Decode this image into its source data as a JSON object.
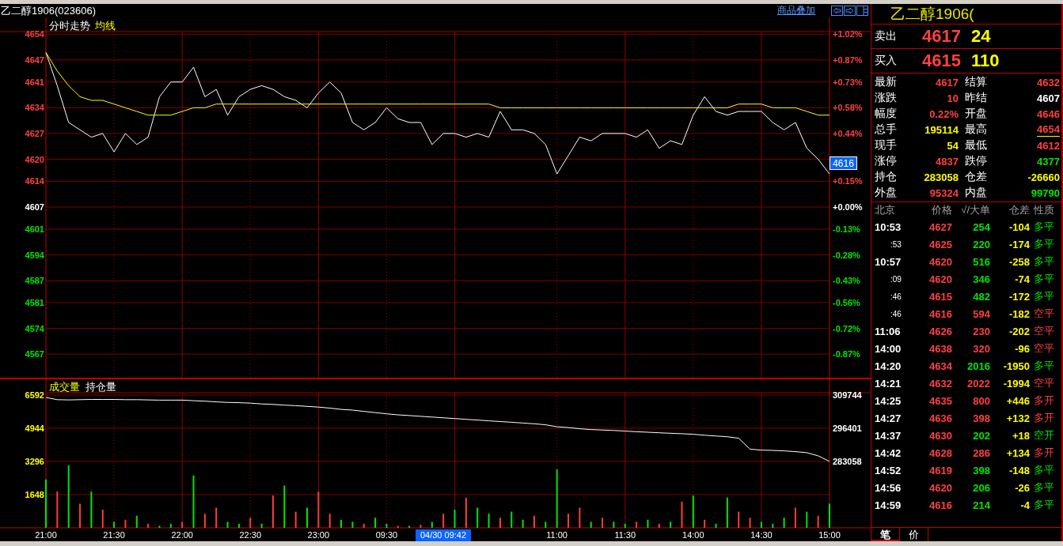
{
  "window": {
    "title": "乙二醇1906(023606)"
  },
  "overlay_link": "商品叠加",
  "price_chart": {
    "last_price_tag": "4616",
    "axis_labels": [
      {
        "percent": "+1.02%",
        "color": "#ff4040"
      },
      {
        "percent": "+0.87%",
        "color": "#ff4040"
      },
      {
        "percent": "+0.73%",
        "color": "#ff4040"
      },
      {
        "percent": "+0.58%",
        "color": "#ff4040"
      },
      {
        "percent": "+0.44%",
        "color": "#ff4040"
      },
      {
        "color": "#ff4040"
      },
      {
        "percent": "+0.15%",
        "color": "#ff4040"
      },
      {
        "percent": "+0.00%",
        "color": "#ffffff"
      },
      {
        "percent": "-0.13%",
        "color": "#00e600"
      },
      {
        "percent": "-0.28%",
        "color": "#00e600"
      },
      {
        "percent": "-0.43%",
        "color": "#00e600"
      },
      {
        "percent": "-0.56%",
        "color": "#00e600"
      },
      {
        "percent": "-0.72%",
        "color": "#00e600"
      },
      {
        "percent": "-0.87%",
        "color": "#00e600"
      }
    ],
    "chart_data": {
      "type": "line",
      "grid": true,
      "ylim": [
        4560.6,
        4654.7
      ],
      "yticks": [
        4654,
        4647,
        4641,
        4634,
        4627,
        4620,
        4614,
        4607,
        4601,
        4594,
        4587,
        4581,
        4574,
        4567
      ],
      "series": [
        {
          "name": "分时走势",
          "color": "#ffffff",
          "values": [
            4649,
            4640,
            4630,
            4628,
            4626,
            4627,
            4622,
            4627,
            4624,
            4626,
            4637,
            4641,
            4641,
            4645,
            4637,
            4639,
            4632,
            4637,
            4639,
            4640,
            4639,
            4637,
            4636,
            4634,
            4638,
            4641,
            4638,
            4630,
            4628,
            4630,
            4634,
            4631,
            4630,
            4630,
            4624,
            4627,
            4627,
            4626,
            4627,
            4626,
            4633,
            4628,
            4628,
            4627,
            4624,
            4616,
            4621,
            4626,
            4625,
            4627,
            4627,
            4627,
            4626,
            4628,
            4623,
            4625,
            4624,
            4632,
            4637,
            4633,
            4632,
            4633,
            4633,
            4633,
            4630,
            4628,
            4630,
            4623,
            4620,
            4616
          ]
        },
        {
          "name": "均线",
          "color": "#ffff00",
          "values": [
            4649,
            4644,
            4640,
            4637,
            4636,
            4636,
            4635,
            4634,
            4633,
            4632,
            4632,
            4632,
            4633,
            4634,
            4634,
            4635,
            4635,
            4635,
            4635,
            4635,
            4635,
            4635,
            4635,
            4635,
            4635,
            4635,
            4635,
            4635,
            4635,
            4635,
            4635,
            4635,
            4635,
            4635,
            4635,
            4635,
            4635,
            4635,
            4635,
            4635,
            4634,
            4634,
            4634,
            4634,
            4634,
            4634,
            4634,
            4634,
            4634,
            4634,
            4634,
            4634,
            4634,
            4634,
            4634,
            4634,
            4634,
            4634,
            4634,
            4634,
            4634,
            4635,
            4635,
            4635,
            4634,
            4634,
            4634,
            4633,
            4632,
            4632
          ]
        }
      ]
    }
  },
  "volume_chart": {
    "legend": [
      "成交量",
      "持仓量"
    ],
    "cursor_label": "04/30 09:42",
    "chart_data": {
      "type": "bar",
      "grid": true,
      "ylim": [
        0,
        6710
      ],
      "yticks": [
        6592,
        4944,
        3296,
        1648
      ],
      "categories": [
        "21:00",
        null,
        null,
        null,
        null,
        null,
        "21:30",
        null,
        null,
        null,
        null,
        null,
        "22:00",
        null,
        null,
        null,
        null,
        null,
        "22:30",
        null,
        null,
        null,
        null,
        null,
        "23:00",
        null,
        null,
        null,
        null,
        null,
        "09:30",
        null,
        null,
        null,
        null,
        null,
        null,
        null,
        null,
        null,
        null,
        null,
        null,
        null,
        null,
        "11:00",
        null,
        null,
        null,
        null,
        null,
        "11:30",
        null,
        null,
        null,
        null,
        null,
        "14:00",
        null,
        null,
        null,
        null,
        null,
        "14:30",
        null,
        null,
        null,
        null,
        null,
        "15:00"
      ],
      "series": [
        {
          "color": "#ff3c3c",
          "values": [
            null,
            1800,
            null,
            1200,
            null,
            900,
            null,
            400,
            null,
            200,
            null,
            null,
            300,
            null,
            700,
            1000,
            null,
            null,
            500,
            null,
            1600,
            null,
            800,
            null,
            1800,
            700,
            null,
            null,
            200,
            null,
            null,
            100,
            null,
            150,
            null,
            700,
            null,
            1500,
            null,
            null,
            500,
            null,
            null,
            600,
            null,
            null,
            700,
            1000,
            null,
            500,
            null,
            null,
            300,
            null,
            200,
            null,
            1300,
            null,
            400,
            null,
            null,
            800,
            500,
            null,
            null,
            null,
            1000,
            null,
            600,
            null
          ]
        },
        {
          "color": "#00e600",
          "values": [
            2400,
            null,
            3100,
            null,
            1800,
            null,
            300,
            null,
            600,
            null,
            100,
            200,
            null,
            2600,
            null,
            null,
            300,
            200,
            null,
            200,
            null,
            2100,
            null,
            1000,
            null,
            null,
            400,
            300,
            null,
            500,
            200,
            null,
            100,
            null,
            300,
            null,
            900,
            null,
            1000,
            700,
            null,
            800,
            400,
            null,
            300,
            2900,
            null,
            null,
            300,
            null,
            300,
            200,
            null,
            400,
            null,
            300,
            null,
            1600,
            null,
            200,
            1500,
            null,
            null,
            300,
            200,
            500,
            null,
            800,
            null,
            1200
          ]
        }
      ]
    }
  },
  "open_interest": {
    "chart_data": {
      "type": "line",
      "ylim": [
        283058,
        309744
      ],
      "yticks": [
        309744,
        296401,
        283058
      ],
      "series": [
        {
          "color": "#ffffff",
          "values": [
            308800,
            307900,
            307800,
            307900,
            308000,
            308000,
            308000,
            307900,
            307900,
            307800,
            307700,
            307700,
            307700,
            307500,
            307300,
            307000,
            306800,
            306700,
            306500,
            306200,
            306000,
            305700,
            305500,
            305200,
            304900,
            304500,
            304000,
            303700,
            303200,
            302700,
            302200,
            301800,
            301500,
            301200,
            300900,
            300600,
            300300,
            300000,
            299700,
            299400,
            299100,
            298800,
            298500,
            298200,
            297800,
            297000,
            296700,
            296200,
            295900,
            295700,
            295500,
            295300,
            295000,
            294800,
            294600,
            294400,
            294200,
            294000,
            293600,
            293300,
            293000,
            292400,
            288000,
            287600,
            287500,
            287300,
            287000,
            286600,
            285300,
            283100
          ]
        }
      ]
    }
  },
  "right_panel": {
    "title": "乙二醇1906(",
    "quotes": [
      {
        "label": "卖出",
        "price": "4617",
        "volume": "24"
      },
      {
        "label": "买入",
        "price": "4615",
        "volume": "110"
      }
    ],
    "stats": [
      {
        "label": "最新",
        "value": "4617",
        "color": "#ff4040",
        "underlined": false
      },
      {
        "label": "结算",
        "value": "4632",
        "color": "#ff4040",
        "underlined": false
      },
      {
        "label": "涨跌",
        "value": "10",
        "color": "#ff4040",
        "underlined": false
      },
      {
        "label": "昨结",
        "value": "4607",
        "color": "#ffffff",
        "underlined": false
      },
      {
        "label": "幅度",
        "value": "0.22%",
        "color": "#ff4040",
        "underlined": false
      },
      {
        "label": "开盘",
        "value": "4646",
        "color": "#ff4040",
        "underlined": false
      },
      {
        "label": "总手",
        "value": "195114",
        "color": "#ffff00",
        "underlined": false
      },
      {
        "label": "最高",
        "value": "4654",
        "color": "#ff4040",
        "underlined": true
      },
      {
        "label": "现手",
        "value": "54",
        "color": "#ffff00",
        "underlined": false
      },
      {
        "label": "最低",
        "value": "4612",
        "color": "#ff4040",
        "underlined": false
      },
      {
        "label": "涨停",
        "value": "4837",
        "color": "#ff4040",
        "underlined": false
      },
      {
        "label": "跌停",
        "value": "4377",
        "color": "#00e600",
        "underlined": false
      },
      {
        "label": "持仓",
        "value": "283058",
        "color": "#ffff00",
        "underlined": false
      },
      {
        "label": "仓差",
        "value": "-26660",
        "color": "#ffff00",
        "underlined": false
      },
      {
        "label": "外盘",
        "value": "95324",
        "color": "#ff4040",
        "underlined": false
      },
      {
        "label": "内盘",
        "value": "99790",
        "color": "#00e600",
        "underlined": false
      }
    ],
    "trades": {
      "columns": [
        "北京",
        "价格",
        "√/大单",
        "仓差",
        "性质"
      ],
      "rows": [
        {
          "time": "10:53",
          "kind": "full",
          "price": "4627",
          "volume": "254",
          "change": "-104",
          "nature": "多平",
          "color": "#00e600"
        },
        {
          "time": ":53",
          "kind": "short",
          "price": "4625",
          "volume": "220",
          "change": "-174",
          "nature": "多平",
          "color": "#00e600"
        },
        {
          "time": "10:57",
          "kind": "full",
          "price": "4620",
          "volume": "516",
          "change": "-258",
          "nature": "多平",
          "color": "#00e600"
        },
        {
          "time": ":09",
          "kind": "short",
          "price": "4620",
          "volume": "346",
          "change": "-74",
          "nature": "多平",
          "color": "#00e600"
        },
        {
          "time": ":46",
          "kind": "short",
          "price": "4615",
          "volume": "482",
          "change": "-172",
          "nature": "多平",
          "color": "#00e600"
        },
        {
          "time": ":46",
          "kind": "short",
          "price": "4616",
          "volume": "594",
          "change": "-182",
          "nature": "空平",
          "color": "#ff4040"
        },
        {
          "time": "11:06",
          "kind": "full",
          "price": "4626",
          "volume": "230",
          "change": "-202",
          "nature": "空平",
          "color": "#ff4040"
        },
        {
          "time": "14:00",
          "kind": "full",
          "price": "4638",
          "volume": "320",
          "change": "-96",
          "nature": "空平",
          "color": "#ff4040"
        },
        {
          "time": "14:20",
          "kind": "full",
          "price": "4634",
          "volume": "2016",
          "change": "-1950",
          "nature": "多平",
          "color": "#00e600"
        },
        {
          "time": "14:21",
          "kind": "full",
          "price": "4632",
          "volume": "2022",
          "change": "-1994",
          "nature": "空平",
          "color": "#ff4040"
        },
        {
          "time": "14:25",
          "kind": "full",
          "price": "4635",
          "volume": "800",
          "change": "+446",
          "nature": "多开",
          "color": "#ff4040"
        },
        {
          "time": "14:27",
          "kind": "full",
          "price": "4636",
          "volume": "398",
          "change": "+132",
          "nature": "多开",
          "color": "#ff4040"
        },
        {
          "time": "14:37",
          "kind": "full",
          "price": "4630",
          "volume": "202",
          "change": "+18",
          "nature": "空开",
          "color": "#00e600"
        },
        {
          "time": "14:42",
          "kind": "full",
          "price": "4628",
          "volume": "286",
          "change": "+134",
          "nature": "多开",
          "color": "#ff4040"
        },
        {
          "time": "14:52",
          "kind": "full",
          "price": "4619",
          "volume": "398",
          "change": "-148",
          "nature": "多平",
          "color": "#00e600"
        },
        {
          "time": "14:56",
          "kind": "full",
          "price": "4620",
          "volume": "206",
          "change": "-26",
          "nature": "多平",
          "color": "#00e600"
        },
        {
          "time": "14:59",
          "kind": "full",
          "price": "4616",
          "volume": "214",
          "change": "-4",
          "nature": "多平",
          "color": "#00e600"
        }
      ]
    },
    "tabs": [
      {
        "label": "笔",
        "selected": true
      },
      {
        "label": "价",
        "selected": false
      }
    ]
  }
}
